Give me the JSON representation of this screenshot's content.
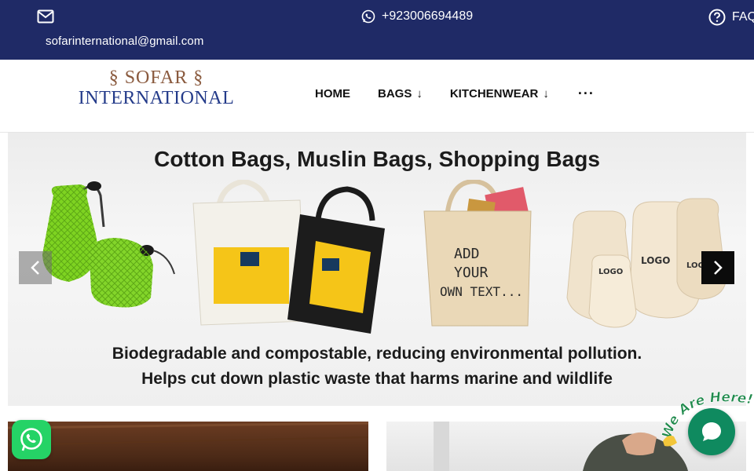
{
  "topbar": {
    "email": "sofarinternational@gmail.com",
    "phone": "+923006694489",
    "faq_label": "FAQ",
    "email_icon": "mail-icon",
    "phone_icon": "whatsapp-icon",
    "faq_icon": "question-circle-icon"
  },
  "logo": {
    "line1": "SOFAR",
    "line2": "INTERNATIONAL"
  },
  "nav": {
    "items": [
      {
        "label": "HOME"
      },
      {
        "label": "BAGS",
        "arrow": "↓"
      },
      {
        "label": "KITCHENWEAR",
        "arrow": "↓"
      }
    ],
    "more": "···"
  },
  "banner": {
    "headline": "Cotton Bags, Muslin Bags, Shopping Bags",
    "caption_line1": "Biodegradable and compostable, reducing environmental pollution.",
    "caption_line2": "Helps cut down plastic waste that harms marine and wildlife",
    "tote_text": [
      "ADD",
      "YOUR",
      "OWN TEXT..."
    ],
    "pouch_logo": "LOGO",
    "prev_icon": "chevron-left-icon",
    "next_icon": "chevron-right-icon"
  },
  "chat": {
    "badge_text": "We Are Here!"
  },
  "colors": {
    "topbar_bg": "#1f2a66",
    "logo_brown": "#8a5a3e",
    "logo_blue": "#243b8a",
    "whatsapp_green": "#25d366",
    "chat_green": "#0f8a5f"
  }
}
